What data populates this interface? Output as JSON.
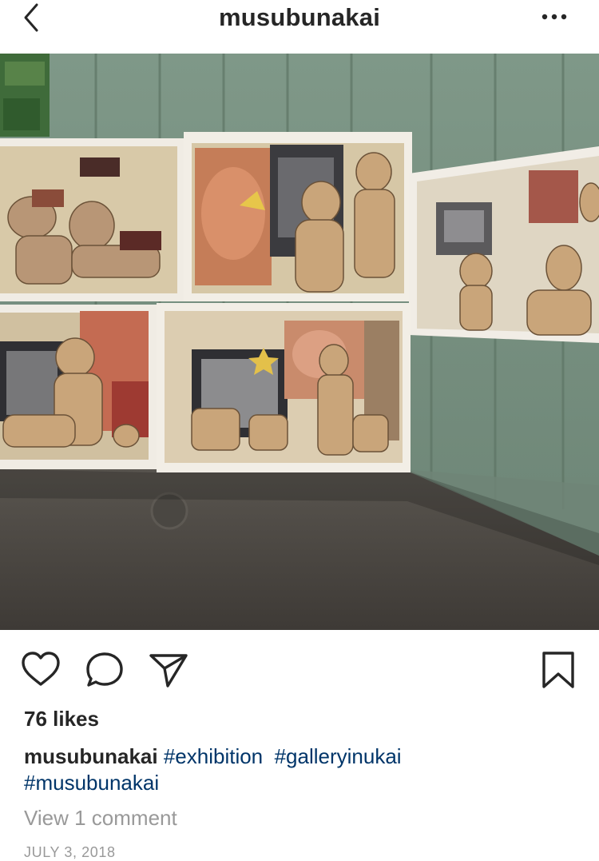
{
  "header": {
    "username": "musubunakai",
    "back_icon": "chevron-left-icon",
    "more_icon": "more-horizontal-icon"
  },
  "post": {
    "photo_icon": "photo-icon"
  },
  "actions": {
    "like_icon": "heart-icon",
    "comment_icon": "comment-bubble-icon",
    "share_icon": "paper-plane-icon",
    "save_icon": "bookmark-icon"
  },
  "likes_text": "76 likes",
  "caption": {
    "username": "musubunakai",
    "hashtags": [
      "#exhibition",
      "#galleryinukai",
      "#musubunakai"
    ]
  },
  "view_comments": "View 1 comment",
  "date": "JULY 3, 2018",
  "colors": {
    "text": "#262626",
    "hashtag": "#003569",
    "muted": "#999999"
  }
}
